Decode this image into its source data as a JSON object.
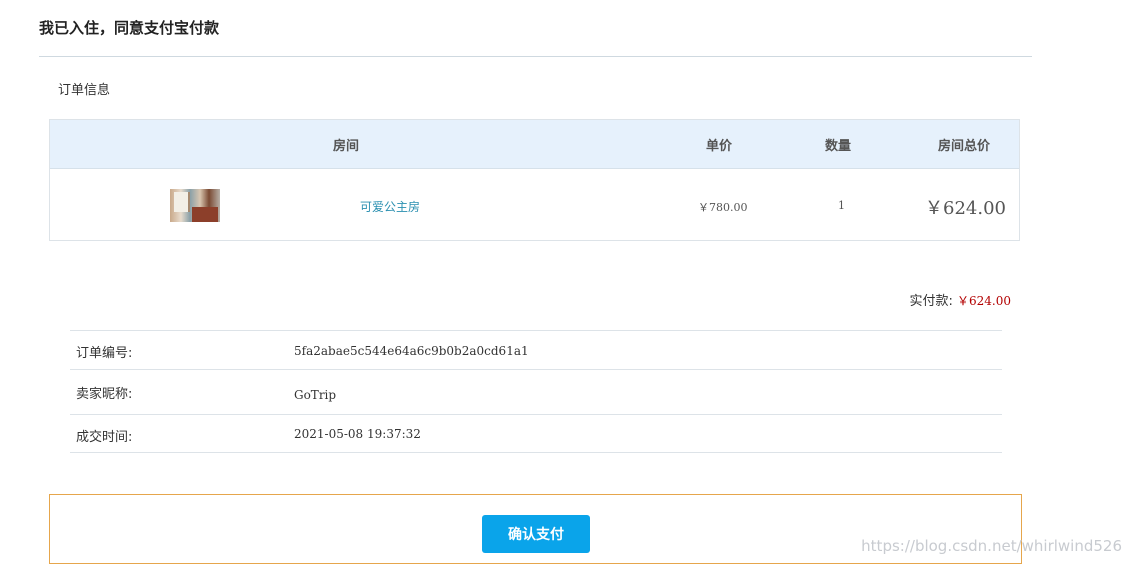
{
  "page": {
    "title": "我已入住，同意支付宝付款",
    "section_label": "订单信息"
  },
  "order_table": {
    "headers": {
      "room": "房间",
      "price": "单价",
      "quantity": "数量",
      "total": "房间总价"
    },
    "row": {
      "room_name": "可爱公主房",
      "price": "￥780.00",
      "quantity": "1",
      "total": "￥624.00"
    }
  },
  "payment": {
    "label": "实付款:",
    "amount": "￥624.00"
  },
  "info": [
    {
      "label": "订单编号:",
      "value": "5fa2abae5c544e64a6c9b0b2a0cd61a1"
    },
    {
      "label": "卖家昵称:",
      "value": "GoTrip"
    },
    {
      "label": "成交时间:",
      "value": "2021-05-08 19:37:32"
    }
  ],
  "confirm": {
    "button_label": "确认支付"
  },
  "watermark": "https://blog.csdn.net/whirlwind526",
  "colors": {
    "accent": "#0aa4ea",
    "table_header_bg": "#e6f1fc",
    "amount_red": "#b30000",
    "confirm_border": "#e6a64c",
    "room_link": "#2a8fb0"
  }
}
